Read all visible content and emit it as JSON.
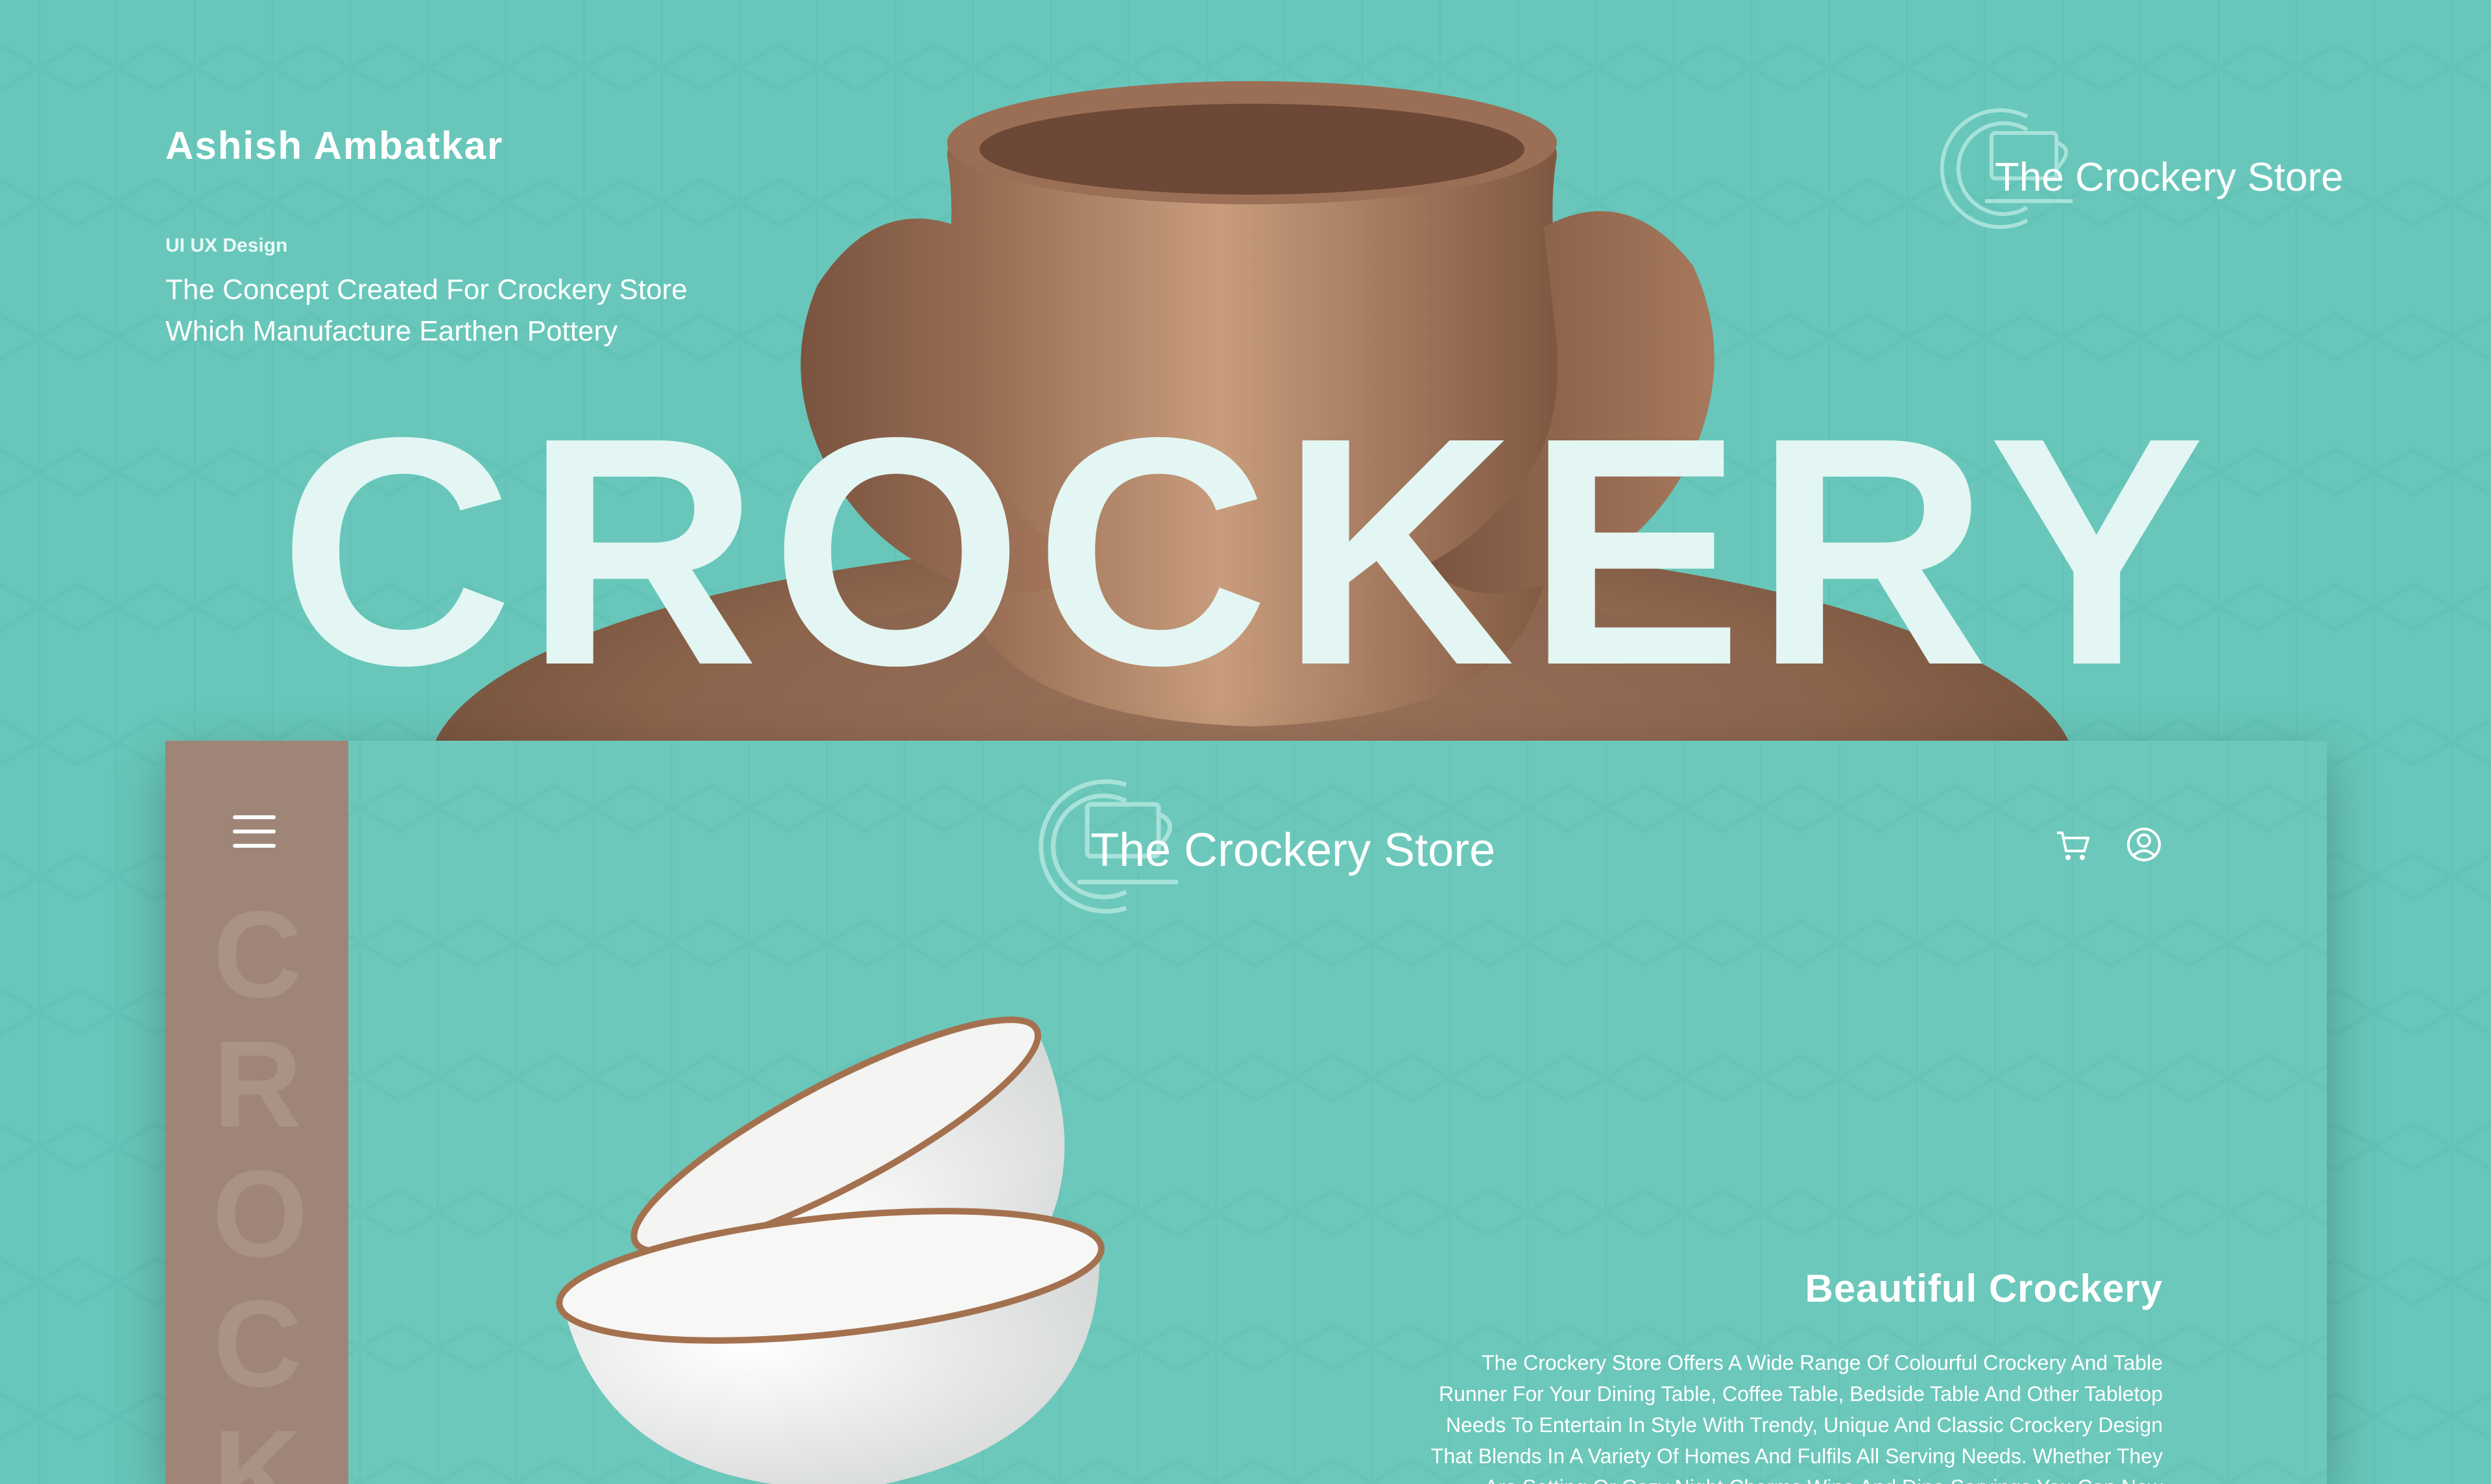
{
  "hero": {
    "author": "Ashish Ambatkar",
    "tag": "UI UX Design",
    "description": "The Concept Created For Crockery Store Which Manufacture Earthen Pottery",
    "big_word": "CROCKERY",
    "logo_text": "The Crockery Store"
  },
  "mockup": {
    "sidebar_letters": [
      "C",
      "R",
      "O",
      "C",
      "K"
    ],
    "logo_text": "The Crockery Store",
    "headline": "Beautiful Crockery",
    "body": "The Crockery Store Offers A Wide Range Of Colourful Crockery And Table Runner For Your Dining Table, Coffee Table, Bedside Table And Other Tabletop Needs To Entertain In Style With Trendy, Unique And Classic Crockery Design That Blends In A Variety Of Homes And Fulfils All Serving Needs. Whether They Are Setting Or Cozy Night Charms Wine And Dine Servings You Can Now",
    "icons": [
      "menu-icon",
      "cart-icon",
      "user-icon"
    ]
  },
  "colors": {
    "background": "#68c7ba",
    "sidebar": "#9f8578",
    "clay": "#a97b5f",
    "text": "#ffffff"
  }
}
